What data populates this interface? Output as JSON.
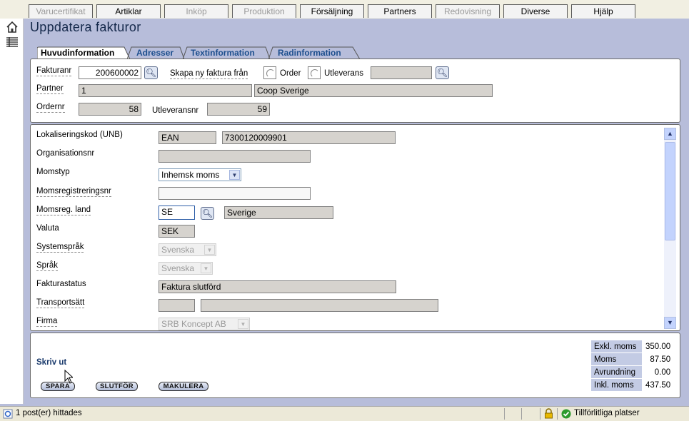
{
  "menu": [
    {
      "label": "Varucertifikat",
      "enabled": false
    },
    {
      "label": "Artiklar",
      "enabled": true
    },
    {
      "label": "Inköp",
      "enabled": false
    },
    {
      "label": "Produktion",
      "enabled": false
    },
    {
      "label": "Försäljning",
      "enabled": true
    },
    {
      "label": "Partners",
      "enabled": true
    },
    {
      "label": "Redovisning",
      "enabled": false
    },
    {
      "label": "Diverse",
      "enabled": true
    },
    {
      "label": "Hjälp",
      "enabled": true
    }
  ],
  "page_title": "Uppdatera fakturor",
  "tabs": [
    "Huvudinformation",
    "Adresser",
    "Textinformation",
    "Radinformation"
  ],
  "header": {
    "fakturanr_label": "Fakturanr",
    "fakturanr_value": "200600002",
    "skapa_label": "Skapa ny faktura från",
    "order_label": "Order",
    "utleverans_label": "Utleverans",
    "utleverans_value": "",
    "partner_label": "Partner",
    "partner_id": "1",
    "partner_name": "Coop Sverige",
    "ordernr_label": "Ordernr",
    "ordernr_value": "58",
    "utleveransnr_label": "Utleveransnr",
    "utleveransnr_value": "59"
  },
  "details": {
    "lokalisering_label": "Lokaliseringskod (UNB)",
    "lokalisering_type": "EAN",
    "lokalisering_value": "7300120009901",
    "org_label": "Organisationsnr",
    "org_value": "",
    "momstyp_label": "Momstyp",
    "momstyp_value": "Inhemsk moms",
    "momsreg_label": "Momsregistreringsnr",
    "momsreg_value": "",
    "momsland_label": "Momsreg. land",
    "momsland_code": "SE",
    "momsland_name": "Sverige",
    "valuta_label": "Valuta",
    "valuta_value": "SEK",
    "systemsprak_label": "Systemspråk",
    "systemsprak_value": "Svenska",
    "sprak_label": "Språk",
    "sprak_value": "Svenska",
    "status_label": "Fakturastatus",
    "status_value": "Faktura slutförd",
    "transport_label": "Transportsätt",
    "transport_code": "",
    "transport_name": "",
    "firma_label": "Firma",
    "firma_value": "SRB Koncept AB"
  },
  "footer": {
    "print_link": "Skriv ut",
    "save_button": "SPARA",
    "finish_button": "SLUTFÖR",
    "cancel_button": "MAKULERA"
  },
  "totals": [
    {
      "label": "Exkl. moms",
      "value": "350.00"
    },
    {
      "label": "Moms",
      "value": "87.50"
    },
    {
      "label": "Avrundning",
      "value": "0.00"
    },
    {
      "label": "Inkl. moms",
      "value": "437.50"
    }
  ],
  "status": {
    "text": "1 post(er) hittades",
    "zone": "Tillförlitliga platser"
  },
  "icons": [
    "home-icon",
    "list-icon",
    "search-icon",
    "lock-icon",
    "check-icon",
    "ie-page-icon"
  ]
}
